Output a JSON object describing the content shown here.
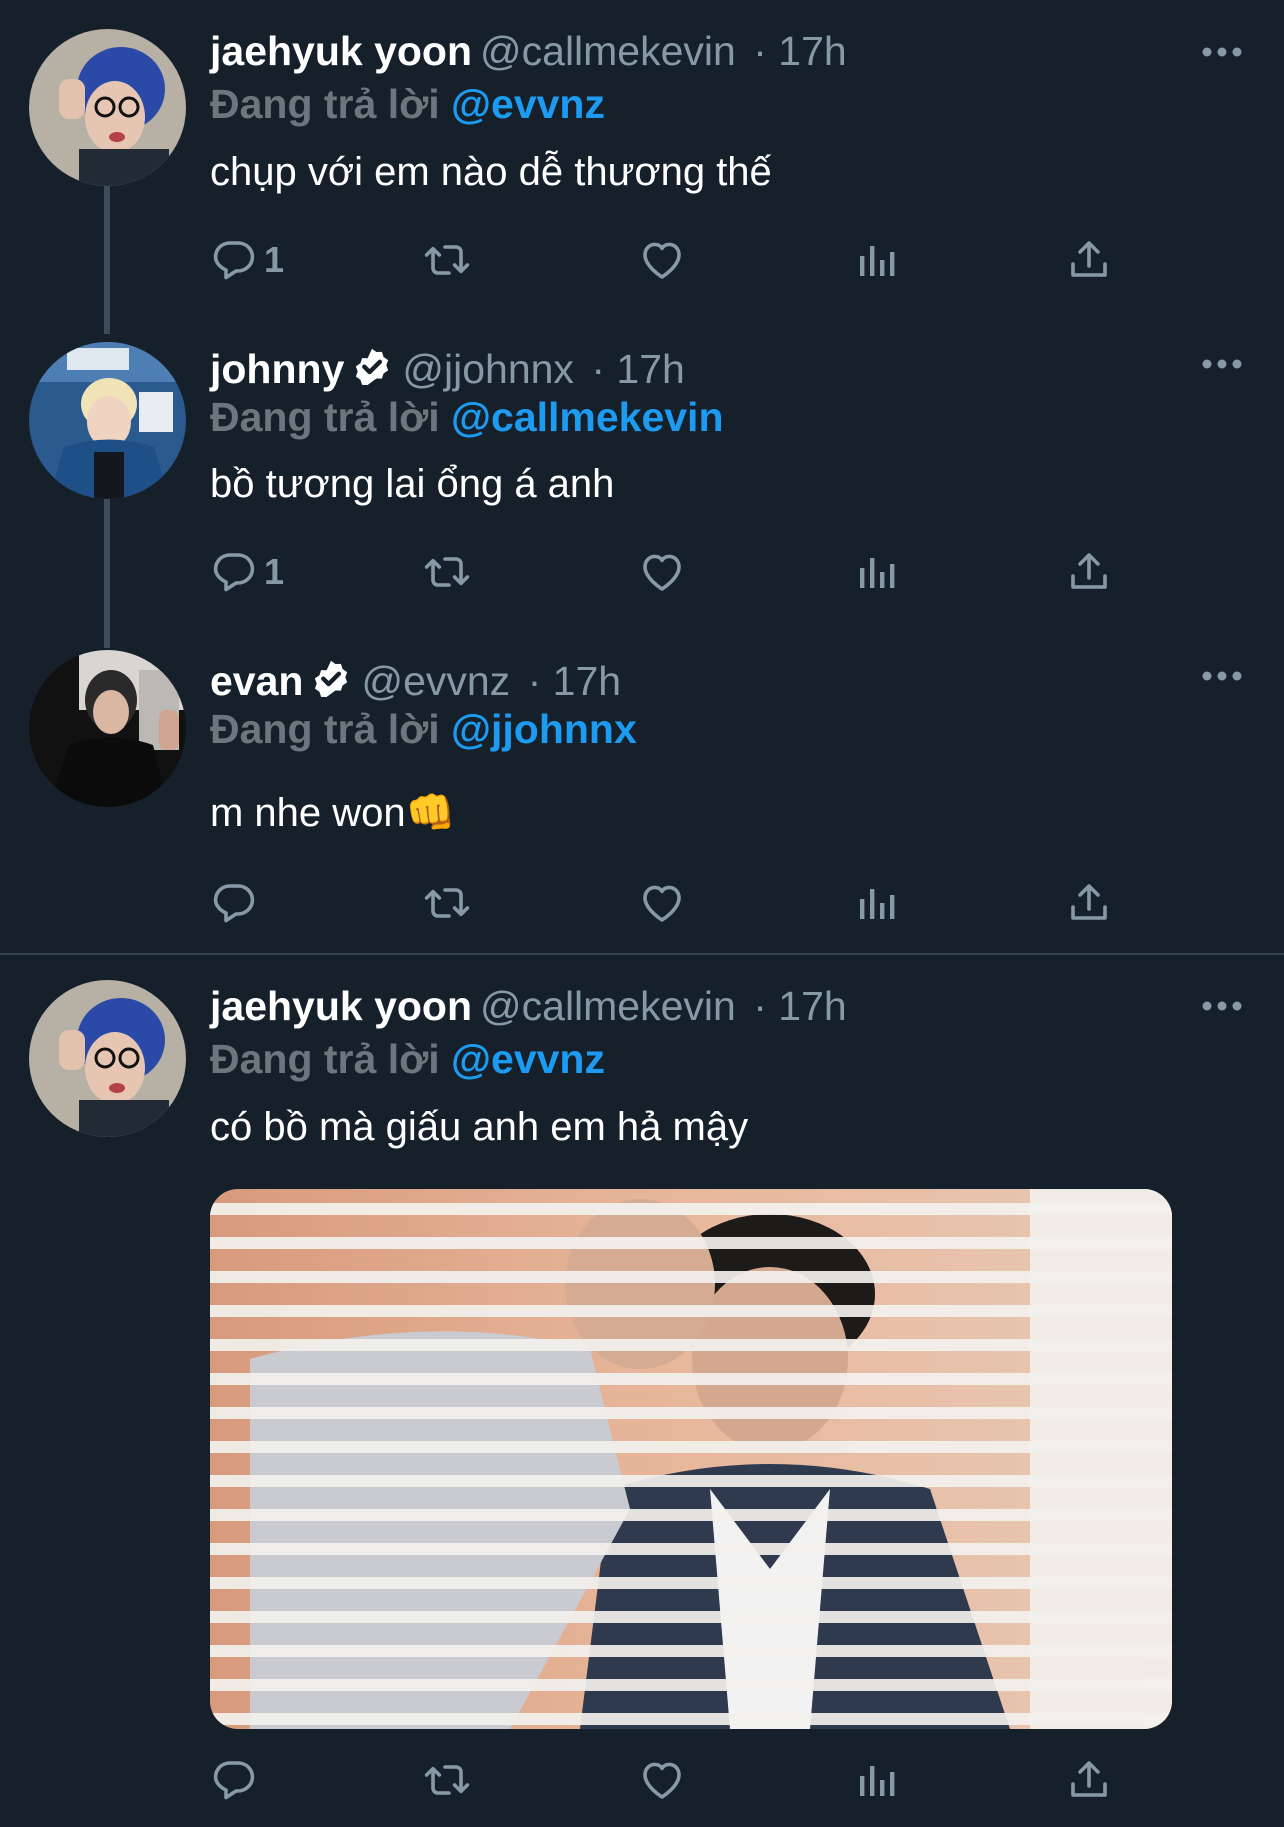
{
  "tweets": [
    {
      "name": "jaehyuk yoon",
      "handle": "@callmekevin",
      "time": "· 17h",
      "reply_prefix": "Đang trả lời",
      "reply_to": "@evvnz",
      "text": "chụp với em nào dễ thương thế",
      "reply_count": "1"
    },
    {
      "name": "johnny",
      "handle": "@jjohnnx",
      "time": "· 17h",
      "reply_prefix": "Đang trả lời",
      "reply_to": "@callmekevin",
      "text": "bồ tương lai ổng á anh",
      "reply_count": "1"
    },
    {
      "name": "evan",
      "handle": "@evvnz",
      "time": "· 17h",
      "reply_prefix": "Đang trả lời",
      "reply_to": "@jjohnnx",
      "text": "m nhe won👊",
      "reply_count": ""
    },
    {
      "name": "jaehyuk yoon",
      "handle": "@callmekevin",
      "time": "· 17h",
      "reply_prefix": "Đang trả lời",
      "reply_to": "@evvnz",
      "text": "có bồ mà giấu anh em hả mậy",
      "reply_count": ""
    }
  ],
  "colors": {
    "background": "#15202b",
    "accent": "#1d9bf0",
    "muted": "#8899a6"
  },
  "icons": [
    "reply-icon",
    "retweet-icon",
    "like-icon",
    "views-icon",
    "share-icon",
    "more-icon",
    "verified-icon"
  ]
}
